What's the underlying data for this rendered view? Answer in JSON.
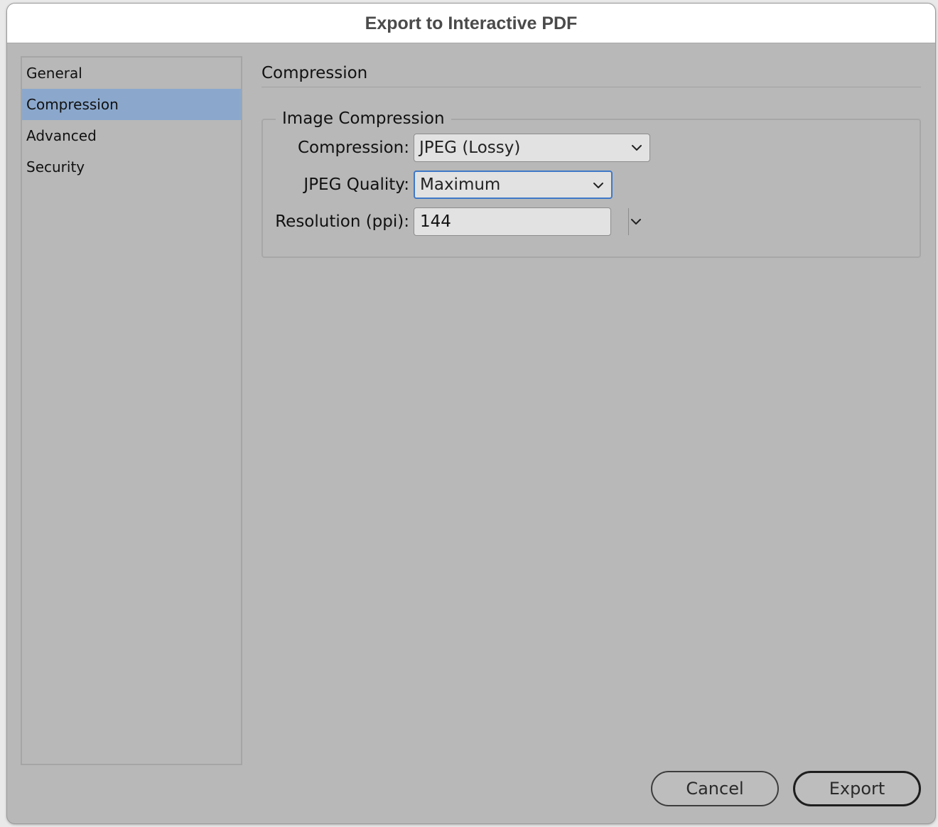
{
  "window": {
    "title": "Export to Interactive PDF"
  },
  "sidebar": {
    "items": [
      {
        "label": "General"
      },
      {
        "label": "Compression"
      },
      {
        "label": "Advanced"
      },
      {
        "label": "Security"
      }
    ],
    "selected": "Compression"
  },
  "content": {
    "section_title": "Compression",
    "image_compression": {
      "legend": "Image Compression",
      "compression": {
        "label": "Compression:",
        "value": "JPEG (Lossy)"
      },
      "jpeg_quality": {
        "label": "JPEG Quality:",
        "value": "Maximum"
      },
      "resolution": {
        "label": "Resolution (ppi):",
        "value": "144"
      }
    }
  },
  "buttons": {
    "cancel": "Cancel",
    "export": "Export"
  },
  "colors": {
    "background": "#b8b8b8",
    "selection": "#8ba8cc",
    "focus_ring": "#3f78c8"
  },
  "icons": {
    "dropdown": "chevron-down-icon"
  }
}
